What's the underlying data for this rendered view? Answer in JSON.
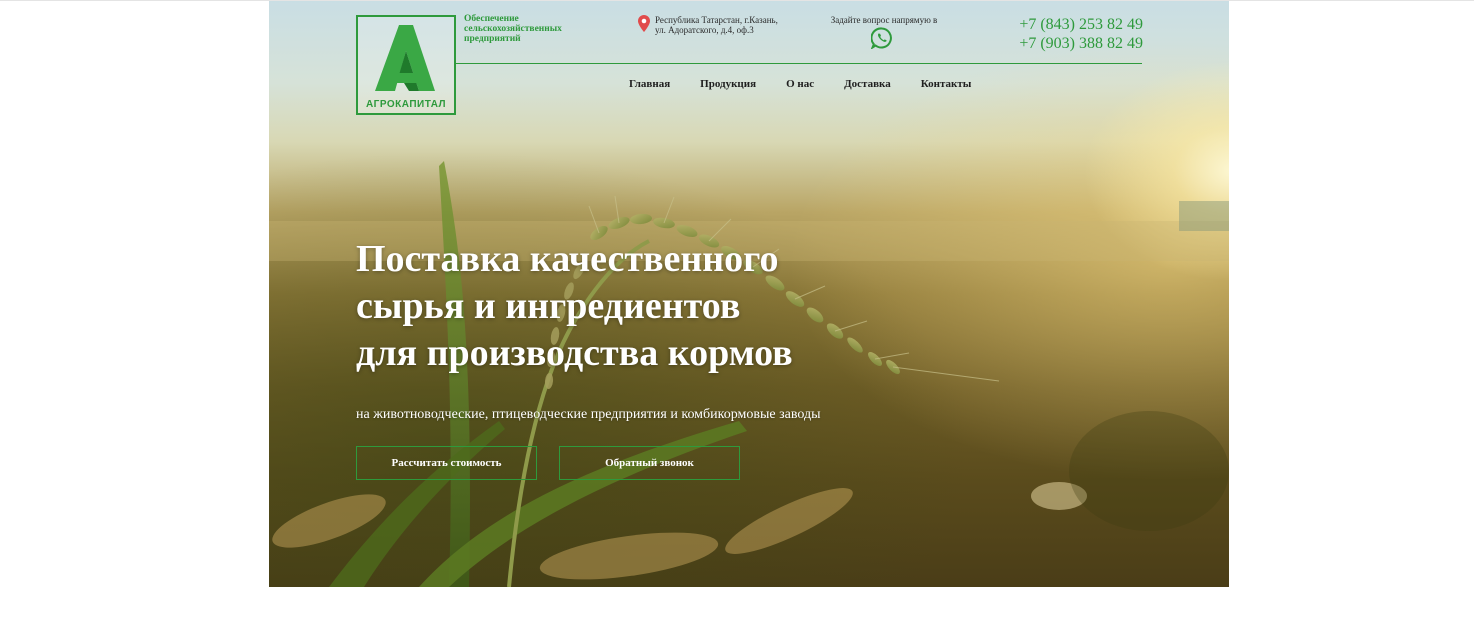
{
  "brand": {
    "logo_text": "АГРОКАПИТАЛ",
    "tagline": "Обеспечение сельскохозяйственных предприятий",
    "accent_color": "#2e9a3c"
  },
  "contact": {
    "address_line1": "Республика Татарстан, г.Казань,",
    "address_line2": "ул. Адоратского, д.4, оф.3",
    "ask_text": "Задайте вопрос напрямую в",
    "messenger_icon": "whatsapp-icon",
    "location_icon": "map-pin-icon",
    "phone1": "+7 (843) 253 82 49",
    "phone2": "+7 (903) 388 82 49"
  },
  "nav": {
    "items": [
      {
        "label": "Главная"
      },
      {
        "label": "Продукция"
      },
      {
        "label": "О нас"
      },
      {
        "label": "Доставка"
      },
      {
        "label": "Контакты"
      }
    ]
  },
  "hero": {
    "headline_line1": "Поставка качественного",
    "headline_line2": "сырья и ингредиентов",
    "headline_line3": "для производства кормов",
    "subline": "на животноводческие, птицеводческие предприятия и комбикормовые заводы",
    "btn_calc": "Рассчитать стоимость",
    "btn_call": "Обратный звонок"
  }
}
